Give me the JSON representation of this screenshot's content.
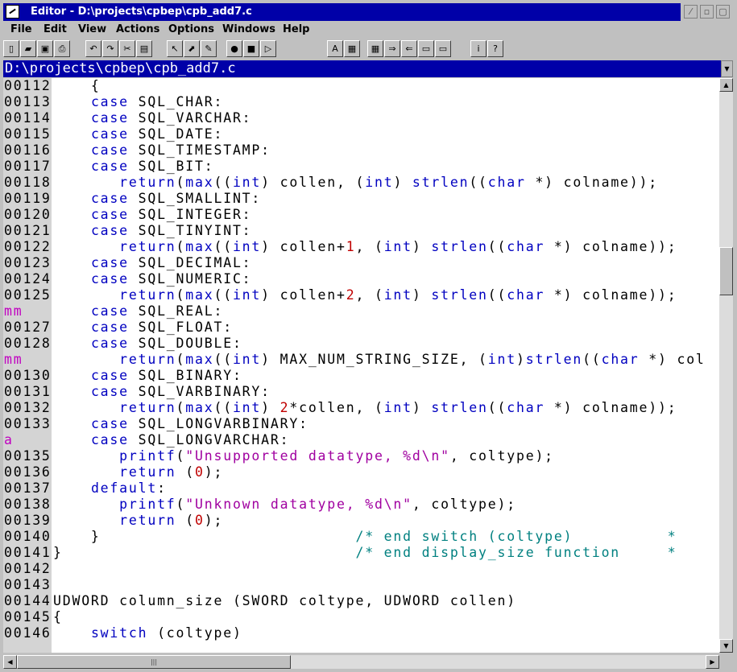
{
  "window": {
    "title": "Editor - D:\\projects\\cpbep\\cpb_add7.c",
    "min_label": "▢",
    "restore_label": "▫",
    "max_label": "▢"
  },
  "menu": [
    "File",
    "Edit",
    "View",
    "Actions",
    "Options",
    "Windows",
    "Help"
  ],
  "toolbar": [
    {
      "icon": "new-file-icon",
      "glyph": "▯"
    },
    {
      "icon": "open-folder-icon",
      "glyph": "▰"
    },
    {
      "icon": "save-icon",
      "glyph": "▣"
    },
    {
      "icon": "print-icon",
      "glyph": "⎙"
    },
    {
      "icon": "undo-icon",
      "glyph": "↶"
    },
    {
      "icon": "redo-icon",
      "glyph": "↷"
    },
    {
      "icon": "cut-icon",
      "glyph": "✂"
    },
    {
      "icon": "paste-icon",
      "glyph": "▤"
    },
    {
      "icon": "cursor-icon",
      "glyph": "↖"
    },
    {
      "icon": "select-icon",
      "glyph": "⬈"
    },
    {
      "icon": "pencil-icon",
      "glyph": "✎"
    },
    {
      "icon": "record-icon",
      "glyph": "●"
    },
    {
      "icon": "stop-icon",
      "glyph": "■"
    },
    {
      "icon": "play-icon",
      "glyph": "▷"
    },
    {
      "icon": "font-icon",
      "glyph": "A"
    },
    {
      "icon": "grid-icon",
      "glyph": "▦"
    },
    {
      "icon": "tile-icon",
      "glyph": "▦"
    },
    {
      "icon": "folder-arrow-icon",
      "glyph": "⇒"
    },
    {
      "icon": "folder-back-icon",
      "glyph": "⇐"
    },
    {
      "icon": "compile-icon",
      "glyph": "▭"
    },
    {
      "icon": "build-icon",
      "glyph": "▭"
    },
    {
      "icon": "info-icon",
      "glyph": "i"
    },
    {
      "icon": "help-icon",
      "glyph": "?"
    }
  ],
  "path": "D:\\projects\\cpbep\\cpb_add7.c",
  "lines": [
    {
      "n": "00112",
      "mark": false,
      "t": [
        [
          "",
          "    {"
        ]
      ]
    },
    {
      "n": "00113",
      "mark": false,
      "t": [
        [
          "",
          "    "
        ],
        [
          "kw",
          "case"
        ],
        [
          "",
          " SQL_CHAR:"
        ]
      ]
    },
    {
      "n": "00114",
      "mark": false,
      "t": [
        [
          "",
          "    "
        ],
        [
          "kw",
          "case"
        ],
        [
          "",
          " SQL_VARCHAR:"
        ]
      ]
    },
    {
      "n": "00115",
      "mark": false,
      "t": [
        [
          "",
          "    "
        ],
        [
          "kw",
          "case"
        ],
        [
          "",
          " SQL_DATE:"
        ]
      ]
    },
    {
      "n": "00116",
      "mark": false,
      "t": [
        [
          "",
          "    "
        ],
        [
          "kw",
          "case"
        ],
        [
          "",
          " SQL_TIMESTAMP:"
        ]
      ]
    },
    {
      "n": "00117",
      "mark": false,
      "t": [
        [
          "",
          "    "
        ],
        [
          "kw",
          "case"
        ],
        [
          "",
          " SQL_BIT:"
        ]
      ]
    },
    {
      "n": "00118",
      "mark": false,
      "t": [
        [
          "",
          "       "
        ],
        [
          "kw",
          "return"
        ],
        [
          "",
          "("
        ],
        [
          "kw",
          "max"
        ],
        [
          "",
          "(("
        ],
        [
          "kw",
          "int"
        ],
        [
          "",
          ") collen, ("
        ],
        [
          "kw",
          "int"
        ],
        [
          "",
          ") "
        ],
        [
          "kw",
          "strlen"
        ],
        [
          "",
          "(("
        ],
        [
          "kw",
          "char"
        ],
        [
          "",
          " *) colname));"
        ]
      ]
    },
    {
      "n": "00119",
      "mark": false,
      "t": [
        [
          "",
          "    "
        ],
        [
          "kw",
          "case"
        ],
        [
          "",
          " SQL_SMALLINT:"
        ]
      ]
    },
    {
      "n": "00120",
      "mark": false,
      "t": [
        [
          "",
          "    "
        ],
        [
          "kw",
          "case"
        ],
        [
          "",
          " SQL_INTEGER:"
        ]
      ]
    },
    {
      "n": "00121",
      "mark": false,
      "t": [
        [
          "",
          "    "
        ],
        [
          "kw",
          "case"
        ],
        [
          "",
          " SQL_TINYINT:"
        ]
      ]
    },
    {
      "n": "00122",
      "mark": false,
      "t": [
        [
          "",
          "       "
        ],
        [
          "kw",
          "return"
        ],
        [
          "",
          "("
        ],
        [
          "kw",
          "max"
        ],
        [
          "",
          "(("
        ],
        [
          "kw",
          "int"
        ],
        [
          "",
          ") collen+"
        ],
        [
          "num",
          "1"
        ],
        [
          "",
          ", ("
        ],
        [
          "kw",
          "int"
        ],
        [
          "",
          ") "
        ],
        [
          "kw",
          "strlen"
        ],
        [
          "",
          "(("
        ],
        [
          "kw",
          "char"
        ],
        [
          "",
          " *) colname));"
        ]
      ]
    },
    {
      "n": "00123",
      "mark": false,
      "t": [
        [
          "",
          "    "
        ],
        [
          "kw",
          "case"
        ],
        [
          "",
          " SQL_DECIMAL:"
        ]
      ]
    },
    {
      "n": "00124",
      "mark": false,
      "t": [
        [
          "",
          "    "
        ],
        [
          "kw",
          "case"
        ],
        [
          "",
          " SQL_NUMERIC:"
        ]
      ]
    },
    {
      "n": "00125",
      "mark": false,
      "t": [
        [
          "",
          "       "
        ],
        [
          "kw",
          "return"
        ],
        [
          "",
          "("
        ],
        [
          "kw",
          "max"
        ],
        [
          "",
          "(("
        ],
        [
          "kw",
          "int"
        ],
        [
          "",
          ") collen+"
        ],
        [
          "num",
          "2"
        ],
        [
          "",
          ", ("
        ],
        [
          "kw",
          "int"
        ],
        [
          "",
          ") "
        ],
        [
          "kw",
          "strlen"
        ],
        [
          "",
          "(("
        ],
        [
          "kw",
          "char"
        ],
        [
          "",
          " *) colname));"
        ]
      ]
    },
    {
      "n": "mm",
      "mark": true,
      "t": [
        [
          "",
          "    "
        ],
        [
          "kw",
          "case"
        ],
        [
          "",
          " SQL_REAL:"
        ]
      ]
    },
    {
      "n": "00127",
      "mark": false,
      "t": [
        [
          "",
          "    "
        ],
        [
          "kw",
          "case"
        ],
        [
          "",
          " SQL_FLOAT:"
        ]
      ]
    },
    {
      "n": "00128",
      "mark": false,
      "t": [
        [
          "",
          "    "
        ],
        [
          "kw",
          "case"
        ],
        [
          "",
          " SQL_DOUBLE:"
        ]
      ]
    },
    {
      "n": "mm",
      "mark": true,
      "t": [
        [
          "",
          "       "
        ],
        [
          "kw",
          "return"
        ],
        [
          "",
          "("
        ],
        [
          "kw",
          "max"
        ],
        [
          "",
          "(("
        ],
        [
          "kw",
          "int"
        ],
        [
          "",
          ") MAX_NUM_STRING_SIZE, ("
        ],
        [
          "kw",
          "int"
        ],
        [
          "",
          ")"
        ],
        [
          "kw",
          "strlen"
        ],
        [
          "",
          "(("
        ],
        [
          "kw",
          "char"
        ],
        [
          "",
          " *) col"
        ]
      ]
    },
    {
      "n": "00130",
      "mark": false,
      "t": [
        [
          "",
          "    "
        ],
        [
          "kw",
          "case"
        ],
        [
          "",
          " SQL_BINARY:"
        ]
      ]
    },
    {
      "n": "00131",
      "mark": false,
      "t": [
        [
          "",
          "    "
        ],
        [
          "kw",
          "case"
        ],
        [
          "",
          " SQL_VARBINARY:"
        ]
      ]
    },
    {
      "n": "00132",
      "mark": false,
      "t": [
        [
          "",
          "       "
        ],
        [
          "kw",
          "return"
        ],
        [
          "",
          "("
        ],
        [
          "kw",
          "max"
        ],
        [
          "",
          "(("
        ],
        [
          "kw",
          "int"
        ],
        [
          "",
          ") "
        ],
        [
          "num",
          "2"
        ],
        [
          "",
          "*collen, ("
        ],
        [
          "kw",
          "int"
        ],
        [
          "",
          ") "
        ],
        [
          "kw",
          "strlen"
        ],
        [
          "",
          "(("
        ],
        [
          "kw",
          "char"
        ],
        [
          "",
          " *) colname));"
        ]
      ]
    },
    {
      "n": "00133",
      "mark": false,
      "t": [
        [
          "",
          "    "
        ],
        [
          "kw",
          "case"
        ],
        [
          "",
          " SQL_LONGVARBINARY:"
        ]
      ]
    },
    {
      "n": "a",
      "mark": true,
      "t": [
        [
          "",
          "    "
        ],
        [
          "kw",
          "case"
        ],
        [
          "",
          " SQL_LONGVARCHAR:"
        ]
      ]
    },
    {
      "n": "00135",
      "mark": false,
      "t": [
        [
          "",
          "       "
        ],
        [
          "kw",
          "printf"
        ],
        [
          "",
          "("
        ],
        [
          "str",
          "\"Unsupported datatype, %d\\n\""
        ],
        [
          "",
          ", coltype);"
        ]
      ]
    },
    {
      "n": "00136",
      "mark": false,
      "t": [
        [
          "",
          "       "
        ],
        [
          "kw",
          "return"
        ],
        [
          "",
          " ("
        ],
        [
          "num",
          "0"
        ],
        [
          "",
          ");"
        ]
      ]
    },
    {
      "n": "00137",
      "mark": false,
      "t": [
        [
          "",
          "    "
        ],
        [
          "kw",
          "default"
        ],
        [
          "",
          ":"
        ]
      ]
    },
    {
      "n": "00138",
      "mark": false,
      "t": [
        [
          "",
          "       "
        ],
        [
          "kw",
          "printf"
        ],
        [
          "",
          "("
        ],
        [
          "str",
          "\"Unknown datatype, %d\\n\""
        ],
        [
          "",
          ", coltype);"
        ]
      ]
    },
    {
      "n": "00139",
      "mark": false,
      "t": [
        [
          "",
          "       "
        ],
        [
          "kw",
          "return"
        ],
        [
          "",
          " ("
        ],
        [
          "num",
          "0"
        ],
        [
          "",
          ");"
        ]
      ]
    },
    {
      "n": "00140",
      "mark": false,
      "t": [
        [
          "",
          "    }                           "
        ],
        [
          "cmt",
          "/* end switch (coltype)          *"
        ]
      ]
    },
    {
      "n": "00141",
      "mark": false,
      "t": [
        [
          "",
          "}                               "
        ],
        [
          "cmt",
          "/* end display_size function     *"
        ]
      ]
    },
    {
      "n": "00142",
      "mark": false,
      "t": [
        [
          "",
          ""
        ]
      ]
    },
    {
      "n": "00143",
      "mark": false,
      "t": [
        [
          "",
          ""
        ]
      ]
    },
    {
      "n": "00144",
      "mark": false,
      "t": [
        [
          "",
          "UDWORD column_size (SWORD coltype, UDWORD collen)"
        ]
      ]
    },
    {
      "n": "00145",
      "mark": false,
      "t": [
        [
          "",
          "{"
        ]
      ]
    },
    {
      "n": "00146",
      "mark": false,
      "t": [
        [
          "",
          "    "
        ],
        [
          "kw",
          "switch"
        ],
        [
          "",
          " (coltype)"
        ]
      ]
    }
  ],
  "scroll": {
    "vertical_position": 0.32,
    "horizontal_position": 0.0
  }
}
